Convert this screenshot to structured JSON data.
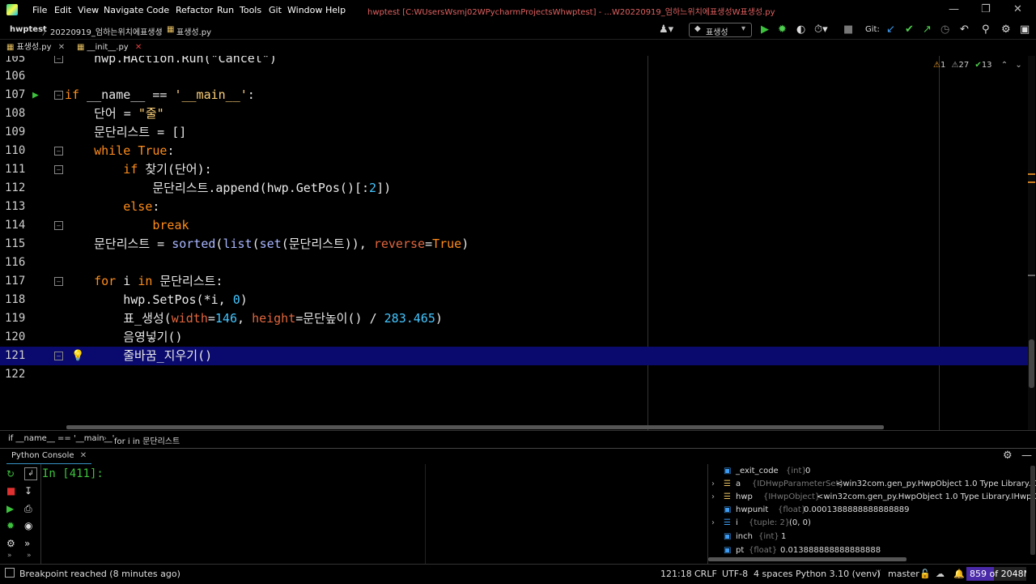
{
  "menu": [
    "File",
    "Edit",
    "View",
    "Navigate",
    "Code",
    "Refactor",
    "Run",
    "Tools",
    "Git",
    "Window",
    "Help"
  ],
  "window_title": "hwptest [C:WUsersWsmj02WPycharmProjectsWhwptest] - ...W20220919_엄하느위치에표생성W표생성.py",
  "nav": {
    "project": "hwptest",
    "folder": "20220919_엄하는위치에표생성",
    "file": "표생성.py",
    "run_config": "표생성",
    "git_label": "Git:"
  },
  "tabs": [
    "표생성.py",
    "__init__.py"
  ],
  "inspections": {
    "warnings": "1",
    "weak_warnings": "27",
    "typos": "13"
  },
  "code_lines": [
    {
      "n": "105",
      "partial": true
    },
    {
      "n": "106"
    },
    {
      "n": "107"
    },
    {
      "n": "108"
    },
    {
      "n": "109"
    },
    {
      "n": "110"
    },
    {
      "n": "111"
    },
    {
      "n": "112"
    },
    {
      "n": "113"
    },
    {
      "n": "114"
    },
    {
      "n": "115"
    },
    {
      "n": "116"
    },
    {
      "n": "117"
    },
    {
      "n": "118"
    },
    {
      "n": "119"
    },
    {
      "n": "120"
    },
    {
      "n": "121"
    },
    {
      "n": "122"
    }
  ],
  "code_text": {
    "l105": "    hwp.HAction.Run(\"Cancel\")",
    "l107a": "if ",
    "l107b": "__name__ == ",
    "l107c": "'__main__'",
    "l107d": ":",
    "l108a": "    단어 = ",
    "l108b": "\"줄\"",
    "l109": "    문단리스트 = []",
    "l110a": "    while ",
    "l110b": "True",
    "l110c": ":",
    "l111a": "        if ",
    "l111b": "찾기(단어):",
    "l112a": "            문단리스트.append(hwp.GetPos()[:",
    "l112b": "2",
    "l112c": "])",
    "l113a": "        else",
    "l113b": ":",
    "l114": "            break",
    "l115a": "    문단리스트 = ",
    "l115b": "sorted",
    "l115c": "(",
    "l115d": "list",
    "l115e": "(",
    "l115f": "set",
    "l115g": "(문단리스트)), ",
    "l115h": "reverse",
    "l115i": "=",
    "l115j": "True",
    "l115k": ")",
    "l117a": "    for ",
    "l117b": "i ",
    "l117c": "in ",
    "l117d": "문단리스트:",
    "l118a": "        hwp.SetPos(*i, ",
    "l118b": "0",
    "l118c": ")",
    "l119a": "        표_생성(",
    "l119b": "width",
    "l119c": "=",
    "l119d": "146",
    "l119e": ", ",
    "l119f": "height",
    "l119g": "=문단높이() / ",
    "l119h": "283.465",
    "l119i": ")",
    "l120": "        음영넣기()",
    "l121": "        줄바꿈_지우기()"
  },
  "editor_breadcrumb": [
    "if __name__ == '__main__'",
    "for i in 문단리스트"
  ],
  "console": {
    "title": "Python Console",
    "prompt": "In [411]:"
  },
  "variables": [
    {
      "name": "_exit_code",
      "type": "{int}",
      "value": "0"
    },
    {
      "name": "a",
      "type": "{IDHwpParameterSet}",
      "value": "<win32com.gen_py.HwpObject 1.0 Type Library.IDH"
    },
    {
      "name": "hwp",
      "type": "{IHwpObject}",
      "value": "<win32com.gen_py.HwpObject 1.0 Type Library.IHwpOb"
    },
    {
      "name": "hwpunit",
      "type": "{float}",
      "value": "0.0001388888888888889"
    },
    {
      "name": "i",
      "type": "{tuple: 2}",
      "value": "(0, 0)"
    },
    {
      "name": "inch",
      "type": "{int}",
      "value": "1"
    },
    {
      "name": "pt",
      "type": "{float}",
      "value": "0.013888888888888888"
    }
  ],
  "status": {
    "message": "Breakpoint reached (8 minutes ago)",
    "position": "121:18",
    "line_sep": "CRLF",
    "encoding": "UTF-8",
    "indent": "4 spaces",
    "interpreter": "Python 3.10 (venv)",
    "branch": "master",
    "memory": "859 of 2048M"
  }
}
